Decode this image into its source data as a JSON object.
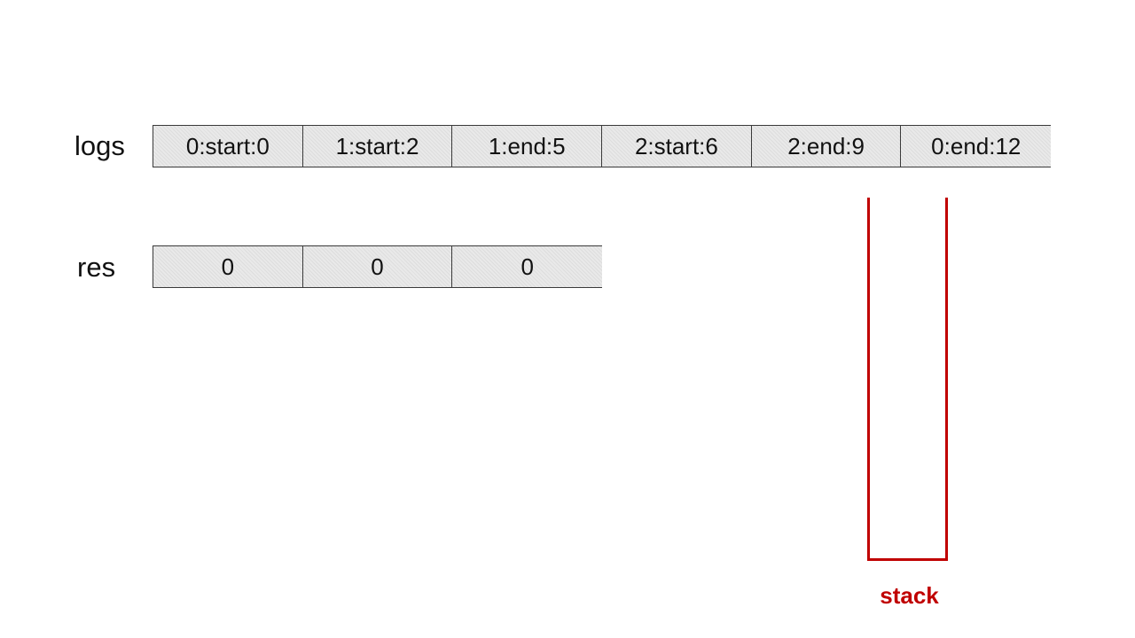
{
  "logs": {
    "label": "logs",
    "cells": [
      "0:start:0",
      "1:start:2",
      "1:end:5",
      "2:start:6",
      "2:end:9",
      "0:end:12"
    ]
  },
  "res": {
    "label": "res",
    "cells": [
      "0",
      "0",
      "0"
    ]
  },
  "stack": {
    "label": "stack",
    "color": "#c00000"
  }
}
